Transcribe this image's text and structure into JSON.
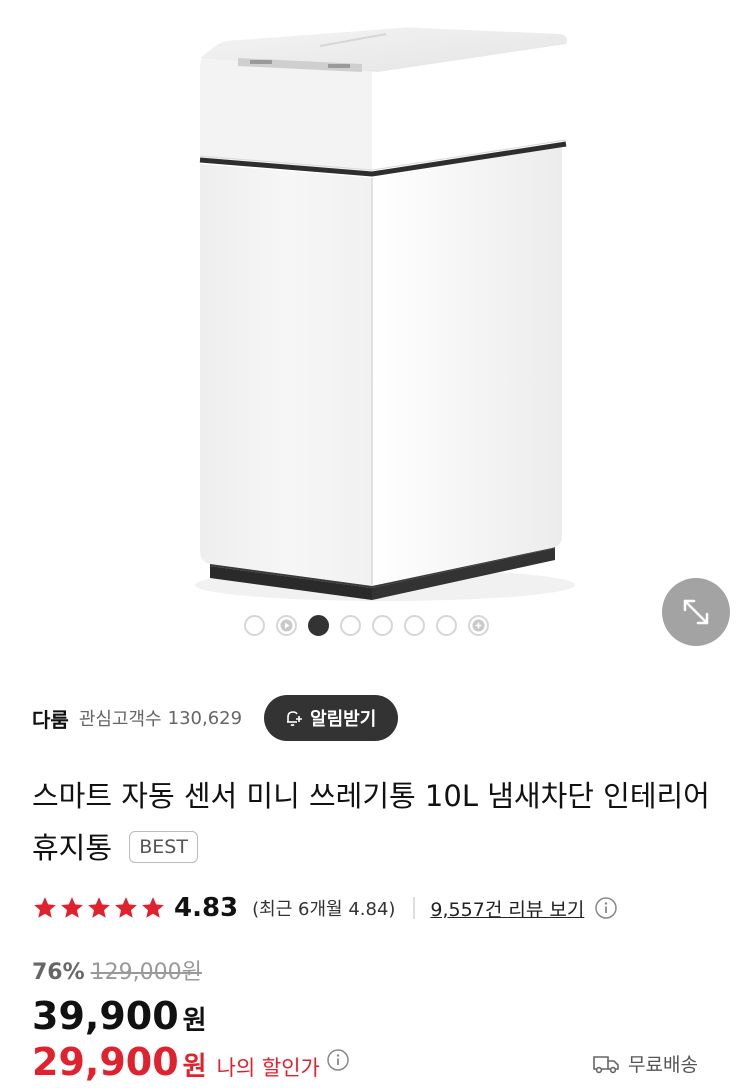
{
  "gallery": {
    "current_index": 3,
    "total": 8
  },
  "seller": {
    "name": "다룸",
    "follower_label": "관심고객수",
    "follower_count": "130,629",
    "alert_button_label": "알림받기"
  },
  "product": {
    "title": "스마트 자동 센서 미니 쓰레기통 10L 냄새차단 인테리어 휴지통",
    "badge": "BEST"
  },
  "rating": {
    "stars": 5,
    "value": "4.83",
    "recent": "(최근 6개월 4.84)",
    "review_link": "9,557건 리뷰 보기"
  },
  "pricing": {
    "discount_rate": "76%",
    "original_price": "129,000원",
    "price": "39,900",
    "price_unit": "원",
    "my_price": "29,900",
    "my_price_unit": "원",
    "my_price_label": "나의 할인가"
  },
  "shipping": {
    "label": "무료배송"
  },
  "colors": {
    "accent_red": "#e0212e",
    "star_red": "#e0212e",
    "dark_button": "#333333"
  }
}
